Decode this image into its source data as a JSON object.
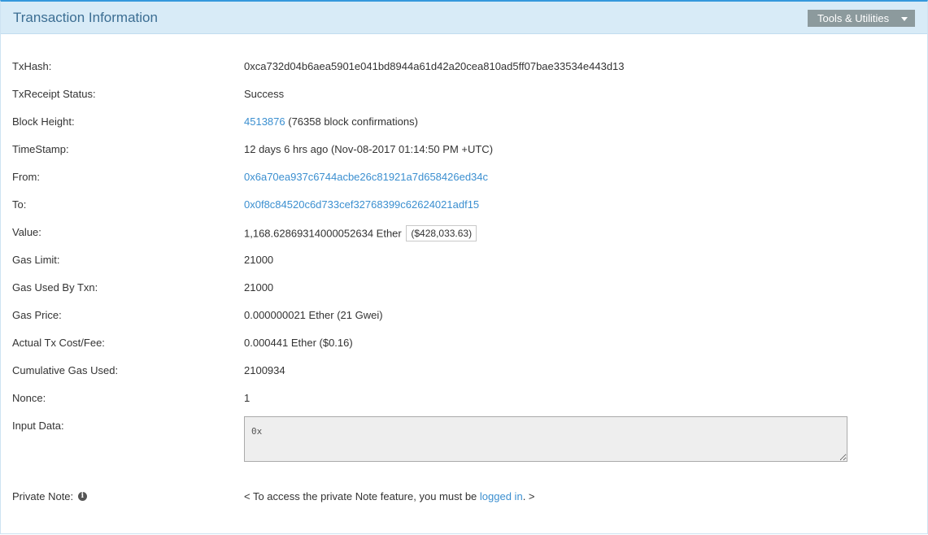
{
  "header": {
    "title": "Transaction Information",
    "tools_label": "Tools & Utilities"
  },
  "rows": {
    "txhash": {
      "label": "TxHash:",
      "value": "0xca732d04b6aea5901e041bd8944a61d42a20cea810ad5ff07bae33534e443d13"
    },
    "status": {
      "label": "TxReceipt Status:",
      "value": "Success"
    },
    "block": {
      "label": "Block Height:",
      "link": "4513876",
      "suffix": " (76358 block confirmations)"
    },
    "timestamp": {
      "label": "TimeStamp:",
      "value": "12 days 6 hrs ago (Nov-08-2017 01:14:50 PM +UTC)"
    },
    "from": {
      "label": "From:",
      "link": "0x6a70ea937c6744acbe26c81921a7d658426ed34c"
    },
    "to": {
      "label": "To:",
      "link": "0x0f8c84520c6d733cef32768399c62624021adf15"
    },
    "value": {
      "label": "Value:",
      "value": "1,168.62869314000052634 Ether",
      "usd": "($428,033.63)"
    },
    "gas_limit": {
      "label": "Gas Limit:",
      "value": "21000"
    },
    "gas_used": {
      "label": "Gas Used By Txn:",
      "value": "21000"
    },
    "gas_price": {
      "label": "Gas Price:",
      "value": "0.000000021 Ether (21 Gwei)"
    },
    "tx_fee": {
      "label": "Actual Tx Cost/Fee:",
      "value": "0.000441 Ether ($0.16)"
    },
    "cumulative_gas": {
      "label": "Cumulative Gas Used:",
      "value": "2100934"
    },
    "nonce": {
      "label": "Nonce:",
      "value": "1"
    },
    "input": {
      "label": "Input Data:",
      "value": "0x"
    },
    "note": {
      "label": "Private Note:",
      "info_icon": "info-circle-icon",
      "prefix": "< To access the private Note feature, you must be ",
      "link": "logged in",
      "suffix": ". >"
    }
  },
  "colors": {
    "accent": "#3598dc",
    "header_bg": "#d8ebf7",
    "link": "#3b8fd0",
    "success": "#2c8a2c",
    "button_bg": "#8c9a9d"
  }
}
